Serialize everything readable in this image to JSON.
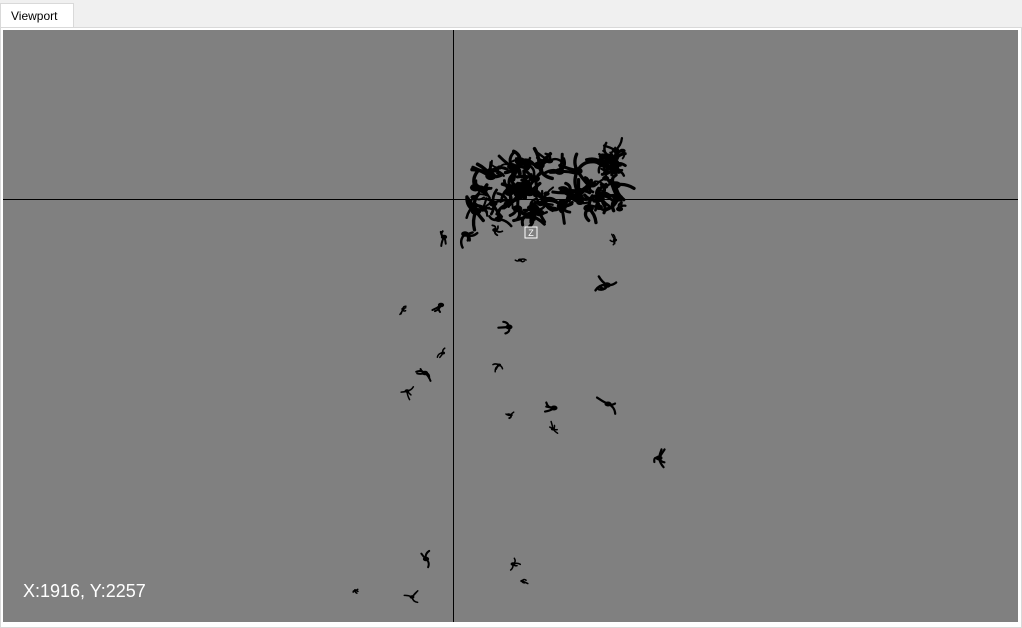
{
  "tabs": [
    {
      "label": "Viewport",
      "active": true
    }
  ],
  "viewport": {
    "background_color": "#808080",
    "crosshair_color": "#000000",
    "mark_color": "#000000",
    "coordinate_readout": "X:1916, Y:2257",
    "selection_marker_label": "Z"
  }
}
